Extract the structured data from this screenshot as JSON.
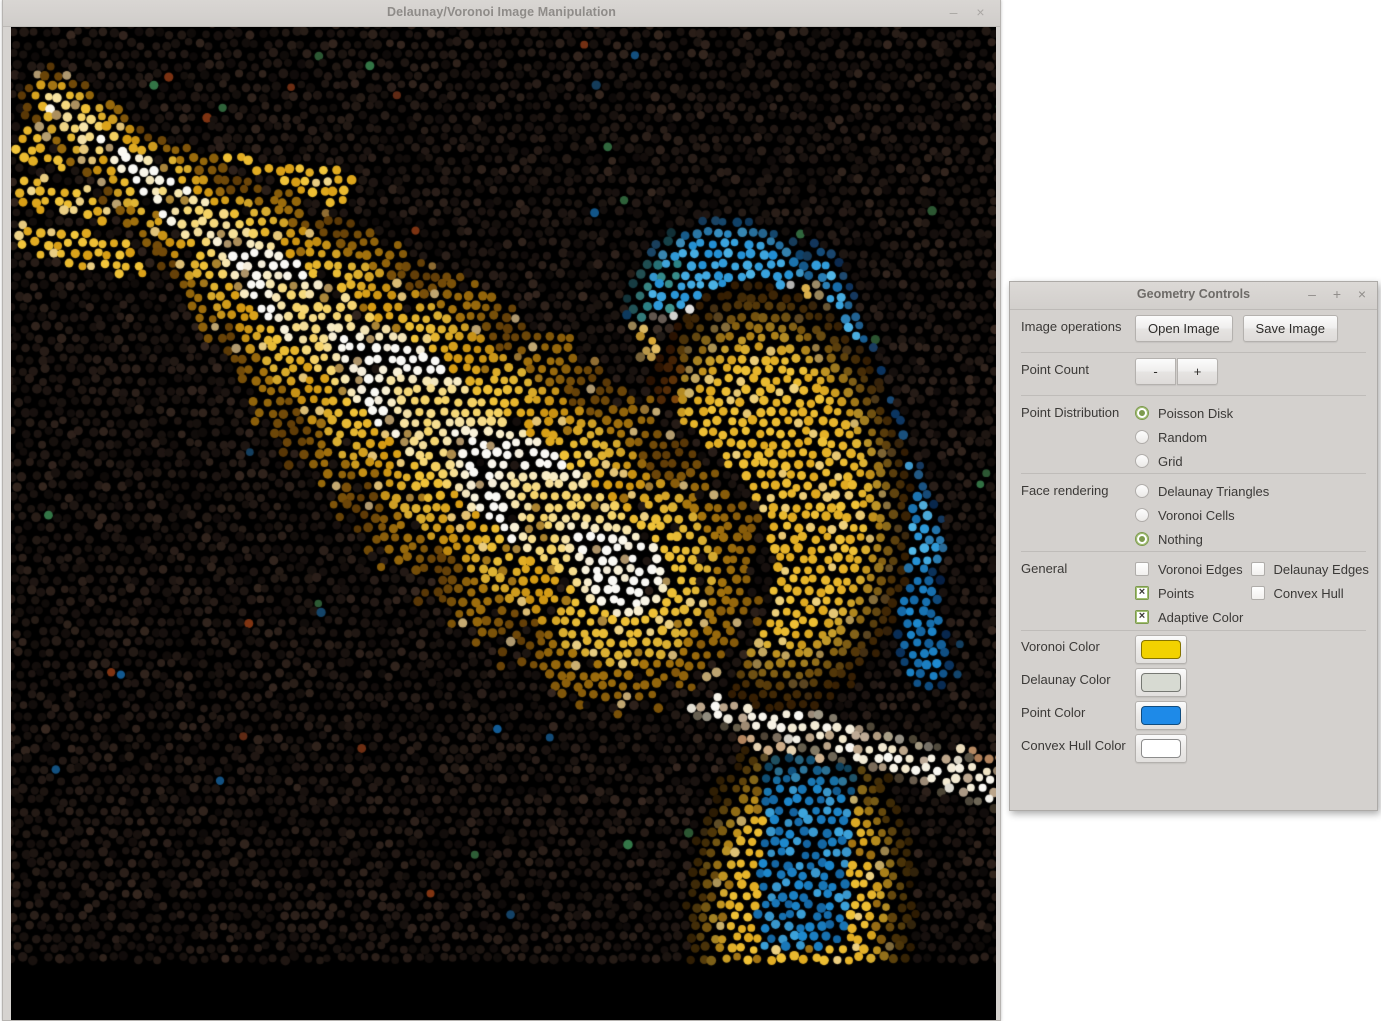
{
  "main_window": {
    "title": "Delaunay/Voronoi Image Manipulation",
    "minimize_label": "–",
    "close_label": "×",
    "canvas": {
      "background_color": "#000000",
      "description": "Stippled point rendering of a blue-and-gold macaw parrot with outstretched wing"
    }
  },
  "panel": {
    "title": "Geometry Controls",
    "minimize_label": "–",
    "maximize_label": "+",
    "close_label": "×",
    "sections": {
      "image_operations": {
        "label": "Image operations",
        "open_button": "Open Image",
        "save_button": "Save Image"
      },
      "point_count": {
        "label": "Point Count",
        "decrement": "-",
        "increment": "+"
      },
      "point_distribution": {
        "label": "Point Distribution",
        "options": [
          {
            "label": "Poisson Disk",
            "selected": true
          },
          {
            "label": "Random",
            "selected": false
          },
          {
            "label": "Grid",
            "selected": false
          }
        ]
      },
      "face_rendering": {
        "label": "Face rendering",
        "options": [
          {
            "label": "Delaunay Triangles",
            "selected": false
          },
          {
            "label": "Voronoi Cells",
            "selected": false
          },
          {
            "label": "Nothing",
            "selected": true
          }
        ]
      },
      "general": {
        "label": "General",
        "checkboxes": [
          {
            "label": "Voronoi Edges",
            "checked": false
          },
          {
            "label": "Delaunay Edges",
            "checked": false
          },
          {
            "label": "Points",
            "checked": true
          },
          {
            "label": "Convex Hull",
            "checked": false
          },
          {
            "label": "Adaptive Color",
            "checked": true
          }
        ]
      },
      "colors": [
        {
          "label": "Voronoi Color",
          "value": "#f2d200"
        },
        {
          "label": "Delaunay Color",
          "value": "#d7dad2"
        },
        {
          "label": "Point Color",
          "value": "#1e8ae8"
        },
        {
          "label": "Convex Hull Color",
          "value": "#ffffff"
        }
      ]
    }
  }
}
